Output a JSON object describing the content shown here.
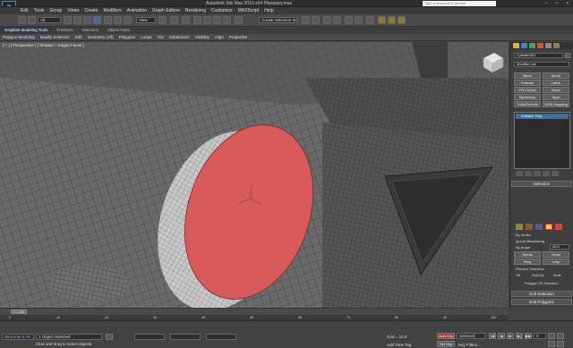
{
  "app": {
    "title": "Autodesk 3ds Max 2013 x64    Planetary.max",
    "search_placeholder": "Type a keyword or phrase",
    "logo": "max-logo"
  },
  "menus": [
    "Edit",
    "Tools",
    "Group",
    "Views",
    "Create",
    "Modifiers",
    "Animation",
    "Graph Editors",
    "Rendering",
    "Customize",
    "MAXScript",
    "Help"
  ],
  "toolbar": {
    "selection_filter": "All",
    "reference_coord": "View",
    "named_selection": "Create Selection Se"
  },
  "ribbon": {
    "tabs": [
      "Graphite Modeling Tools",
      "Freeform",
      "Selection",
      "Object Paint"
    ],
    "active_tab": "Graphite Modeling Tools",
    "panels": [
      "Polygon Modeling",
      "Modify Selection",
      "Edit",
      "Geometry (All)",
      "Polygons",
      "Loops",
      "Tris",
      "Subdivision",
      "Visibility",
      "Align",
      "Properties"
    ]
  },
  "viewport": {
    "label": "[ + ] [ Perspective ] [ Shaded + Edged Faces ]",
    "selected_face_color": "#d95a5a"
  },
  "command_panel": {
    "object_name": "Cylinder001",
    "modifier_list": "Modifier List",
    "modifier_buttons": [
      "Bend",
      "Bevel",
      "Extrude",
      "Lathe",
      "FFD 3x3x3",
      "Mesh",
      "Symmetry",
      "Taper",
      "TurboSmooth",
      "UVW Mapping Cl"
    ],
    "stack": [
      "Editable Poly"
    ],
    "selection": {
      "header": "Selection",
      "by_vertex": "By Vertex",
      "ignore_backfacing": "Ignore Backfacing",
      "by_angle": "By Angle:",
      "by_angle_value": "45.0",
      "shrink": "Shrink",
      "grow": "Grow",
      "ring": "Ring",
      "loop": "Loop",
      "preview_header": "Preview Selection",
      "preview_off": "Off",
      "preview_subobj": "SubObj",
      "preview_multi": "Multi",
      "status": "Polygon 29 Selected"
    },
    "soft_selection": "Soft Selection",
    "edit_polygons": "Edit Polygons",
    "insert_vertex": "Insert Vertex",
    "ops": [
      "Extrude",
      "Outline",
      "Bevel",
      "Inset",
      "Bridge",
      "Flip"
    ],
    "hinge": "Hinge From Edge",
    "extrude_spline": "Extrude Along Spline",
    "edit_triangulation": "Edit Triangulation",
    "retriangulate": "Retriangulate",
    "turn": "Turn"
  },
  "timeline": {
    "slider": "0 / 100",
    "ticks": [
      "0",
      "10",
      "20",
      "30",
      "40",
      "50",
      "60",
      "70",
      "80",
      "90",
      "100"
    ]
  },
  "status": {
    "objects_selected": "1 Object Selected",
    "prompt": "Click and drag to select objects",
    "grid": "Grid = 10.0",
    "auto_key": "Auto Key",
    "set_key": "Set Key",
    "selected": "Selected",
    "add_time_tag": "Add Time Tag",
    "key_filters": "Key Filters...",
    "frame": "0",
    "welcome": "Welcome to M"
  },
  "colors": {
    "accent_blue": "#3f6f9a",
    "face_red": "#d95a5a",
    "auto_key_red": "#b03a3a"
  }
}
